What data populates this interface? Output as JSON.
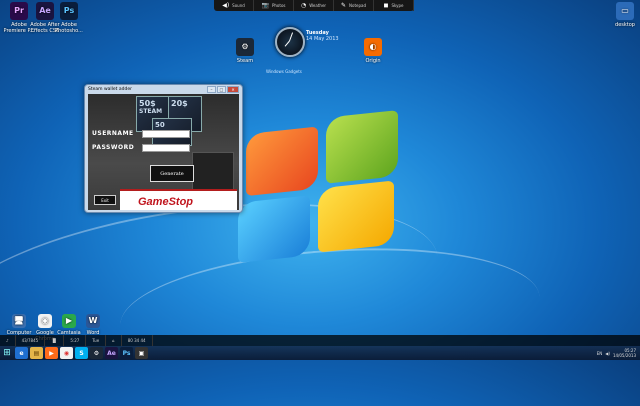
{
  "desktop_icons": [
    {
      "label": "Adobe Premiere P...",
      "glyph": "Pr",
      "bg": "#2a0a4a",
      "fg": "#e6a6ff"
    },
    {
      "label": "Adobe After Effects CS6",
      "glyph": "Ae",
      "bg": "#1a1440",
      "fg": "#c5a6ff"
    },
    {
      "label": "Adobe Photosho...",
      "glyph": "Ps",
      "bg": "#0a1e3c",
      "fg": "#5cc4ff"
    },
    {
      "label": "Steam",
      "glyph": "⚙",
      "bg": "#1b2838",
      "fg": "#fff"
    },
    {
      "label": "Origin",
      "glyph": "◐",
      "bg": "#f56b00",
      "fg": "#fff"
    },
    {
      "label": "desktop",
      "glyph": "▭",
      "bg": "#2c6bb8",
      "fg": "#fff"
    }
  ],
  "bottom_icons": [
    {
      "label": "Computer",
      "glyph": "🖥",
      "bg": "#3a6fb0"
    },
    {
      "label": "Google Chrome",
      "glyph": "◉",
      "bg": "#f2f2f2"
    },
    {
      "label": "Camtasia",
      "glyph": "▶",
      "bg": "#2aa84a"
    },
    {
      "label": "Word",
      "glyph": "W",
      "bg": "#2b5797"
    }
  ],
  "topbar": [
    {
      "icon": "◀)",
      "label": "Sound"
    },
    {
      "icon": "📷",
      "label": "Photos"
    },
    {
      "icon": "◔",
      "label": "Weather"
    },
    {
      "icon": "✎",
      "label": "Notepad"
    },
    {
      "icon": "◼",
      "label": "Skype"
    }
  ],
  "clock": {
    "day": "Tuesday",
    "date": "14 May 2013"
  },
  "note": "Windows Gadgets",
  "window": {
    "title": "Steam wallet adder",
    "card_a": "50$",
    "card_b": "20$",
    "card_c": "50",
    "card_brand": "STEAM",
    "username_label": "USERNAME",
    "password_label": "PASSWORD",
    "generate_label": "Generate",
    "exit_label": "Exit",
    "gamestop": "GameStop"
  },
  "taskbar": {
    "start_glyph": "⊞",
    "items": [
      {
        "glyph": "e",
        "bg": "#1f6fd0",
        "fg": "#fff"
      },
      {
        "glyph": "▤",
        "bg": "#e4b54a",
        "fg": "#5a3a00"
      },
      {
        "glyph": "▶",
        "bg": "#ff6b1a",
        "fg": "#fff"
      },
      {
        "glyph": "◉",
        "bg": "#f2f2f2",
        "fg": "#d33"
      },
      {
        "glyph": "S",
        "bg": "#00aff0",
        "fg": "#fff"
      },
      {
        "glyph": "⚙",
        "bg": "#1b2838",
        "fg": "#fff"
      },
      {
        "glyph": "Ae",
        "bg": "#1a1440",
        "fg": "#c5a6ff"
      },
      {
        "glyph": "Ps",
        "bg": "#0a1e3c",
        "fg": "#5cc4ff"
      },
      {
        "glyph": "▣",
        "bg": "#333",
        "fg": "#fff"
      }
    ],
    "tray_time": "05:27",
    "tray_date": "14/05/2013",
    "lang": "EN"
  },
  "dock": [
    {
      "icon": "♪",
      "text": ""
    },
    {
      "icon": "",
      "text": "43/7845"
    },
    {
      "icon": "▐▌",
      "text": ""
    },
    {
      "icon": "",
      "text": "5:27"
    },
    {
      "icon": "",
      "text": "Tue"
    },
    {
      "icon": "⌂",
      "text": ""
    },
    {
      "icon": "",
      "text": "80  34  44"
    }
  ]
}
